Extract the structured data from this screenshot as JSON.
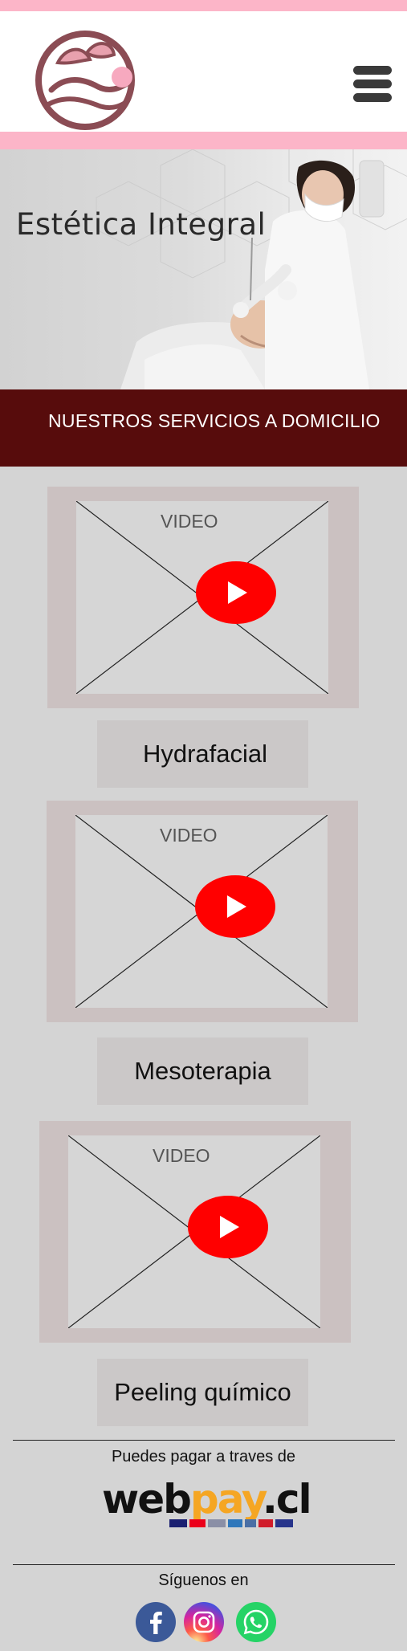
{
  "header": {
    "logo_icon": "lotus-face-logo-icon",
    "menu_icon": "hamburger-menu-icon"
  },
  "hero": {
    "title": "Estética Integral"
  },
  "services_banner": {
    "text": "NUESTROS SERVICIOS A DOMICILIO"
  },
  "services": [
    {
      "video_label": "VIDEO",
      "name": "Hydrafacial"
    },
    {
      "video_label": "VIDEO",
      "name": "Mesoterapia"
    },
    {
      "video_label": "VIDEO",
      "name": "Peeling químico"
    }
  ],
  "footer": {
    "payment_text": "Puedes pagar a traves de",
    "webpay_logo": {
      "part1": "web",
      "part2": "pay",
      "part3": ".cl"
    },
    "follow_text": "Síguenos en",
    "social_icons": [
      "facebook-icon",
      "instagram-icon",
      "whatsapp-icon"
    ]
  },
  "colors": {
    "pink": "#fcb5c8",
    "banner": "#570c0c",
    "play_red": "#ff0000",
    "page_bg": "#d4d4d4"
  }
}
